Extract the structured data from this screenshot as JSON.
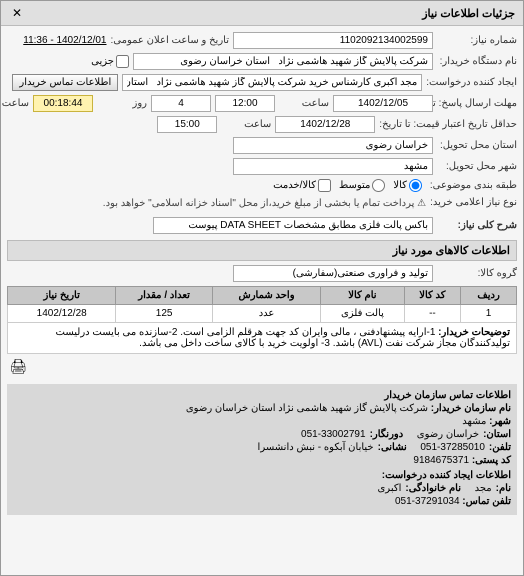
{
  "window": {
    "title": "جزئیات اطلاعات نیاز"
  },
  "fields": {
    "request_number_label": "شماره نیاز:",
    "request_number": "1102092134002599",
    "public_datetime_label": "تاریخ و ساعت اعلان عمومی:",
    "public_datetime": "1402/12/01 - 11:36",
    "buyer_org_label": "نام دستگاه خریدار:",
    "buyer_org": "شرکت پالایش گاز شهید هاشمی نژاد   استان خراسان رضوی",
    "creator_label": "ایجاد کننده درخواست:",
    "creator": "مجد اکبری کارشناس خرید شرکت پالایش گاز شهید هاشمی نژاد   استان خرا",
    "buyer_contact_btn": "اطلاعات تماس خریدار",
    "deadline_label": "مهلت ارسال پاسخ: تا تاریخ:",
    "deadline_date": "1402/12/05",
    "time_label": "ساعت",
    "deadline_time": "12:00",
    "days_label": "روز",
    "days_value": "4",
    "remaining_time": "00:18:44",
    "remaining_label": "ساعت باقی مانده",
    "validity_label": "حداقل تاریخ اعتبار قیمت: تا تاریخ:",
    "validity_date": "1402/12/28",
    "validity_time": "15:00",
    "province_label": "استان محل تحویل:",
    "province": "خراسان رضوی",
    "city_label": "شهر محل تحویل:",
    "city": "مشهد",
    "group_label": "طبقه بندی موضوعی:",
    "group_radio_all": "کالا",
    "group_radio_medium": "متوسط",
    "group_radio_service": "کالا/خدمت",
    "need_type_label": "نوع نیاز اعلامی خرید:",
    "payment_note": "⚠ پرداخت تمام یا بخشی از مبلغ خرید،از محل \"اسناد خزانه اسلامی\" خواهد بود.",
    "desc_label": "شرح کلی نیاز:",
    "desc_value": "باکس پالت فلزی مطابق مشخصات DATA SHEET پیوست"
  },
  "radio_selected": "کالا",
  "goods_section": {
    "title": "اطلاعات کالاهای مورد نیاز",
    "group_label": "گروه کالا:",
    "group_value": "تولید و فرآوری صنعتی(سفارشی)"
  },
  "table": {
    "headers": {
      "row": "ردیف",
      "code": "کد کالا",
      "name": "نام کالا",
      "unit": "واحد شمارش",
      "qty": "تعداد / مقدار",
      "date": "تاریخ نیاز"
    },
    "rows": [
      {
        "row": "1",
        "code": "--",
        "name": "پالت فلزی",
        "unit": "عدد",
        "qty": "125",
        "date": "1402/12/28"
      }
    ],
    "desc_label": "توضیحات خریدار:",
    "desc_text": "1-ارایه پیشنهادفنی ، مالی وایران کد جهت هرقلم الزامی است. 2-سازنده می بایست درلیست تولیدکنندگان مجاز شرکت نفت (AVL) باشد. 3- اولویت خرید با کالای ساخت داخل می باشد."
  },
  "print_icon": "🖨",
  "bottom": {
    "title": "اطلاعات تماس سازمان خریدار",
    "org_label": "نام سازمان خریدار:",
    "org_value": "شرکت پالایش گاز شهید هاشمی نژاد استان خراسان رضوی",
    "city_label": "شهر:",
    "city_value": "مشهد",
    "province_label": "استان:",
    "province_value": "خراسان رضوی",
    "fax_label": "دورنگار:",
    "fax_value": "051-33002791",
    "phone_label": "تلفن:",
    "phone_value": "051-37285010",
    "address_label": "نشانی:",
    "address_value": "خیابان آبکوه - نبش دانشسرا",
    "postcode_label": "کد پستی:",
    "postcode_value": "9184675371",
    "creator_title": "اطلاعات ایجاد کننده درخواست:",
    "name_label": "نام:",
    "name_value": "مجد",
    "lname_label": "نام خانوادگی:",
    "lname_value": "اکبری",
    "cphone_label": "تلفن تماس:",
    "cphone_value": "051-37291034"
  }
}
